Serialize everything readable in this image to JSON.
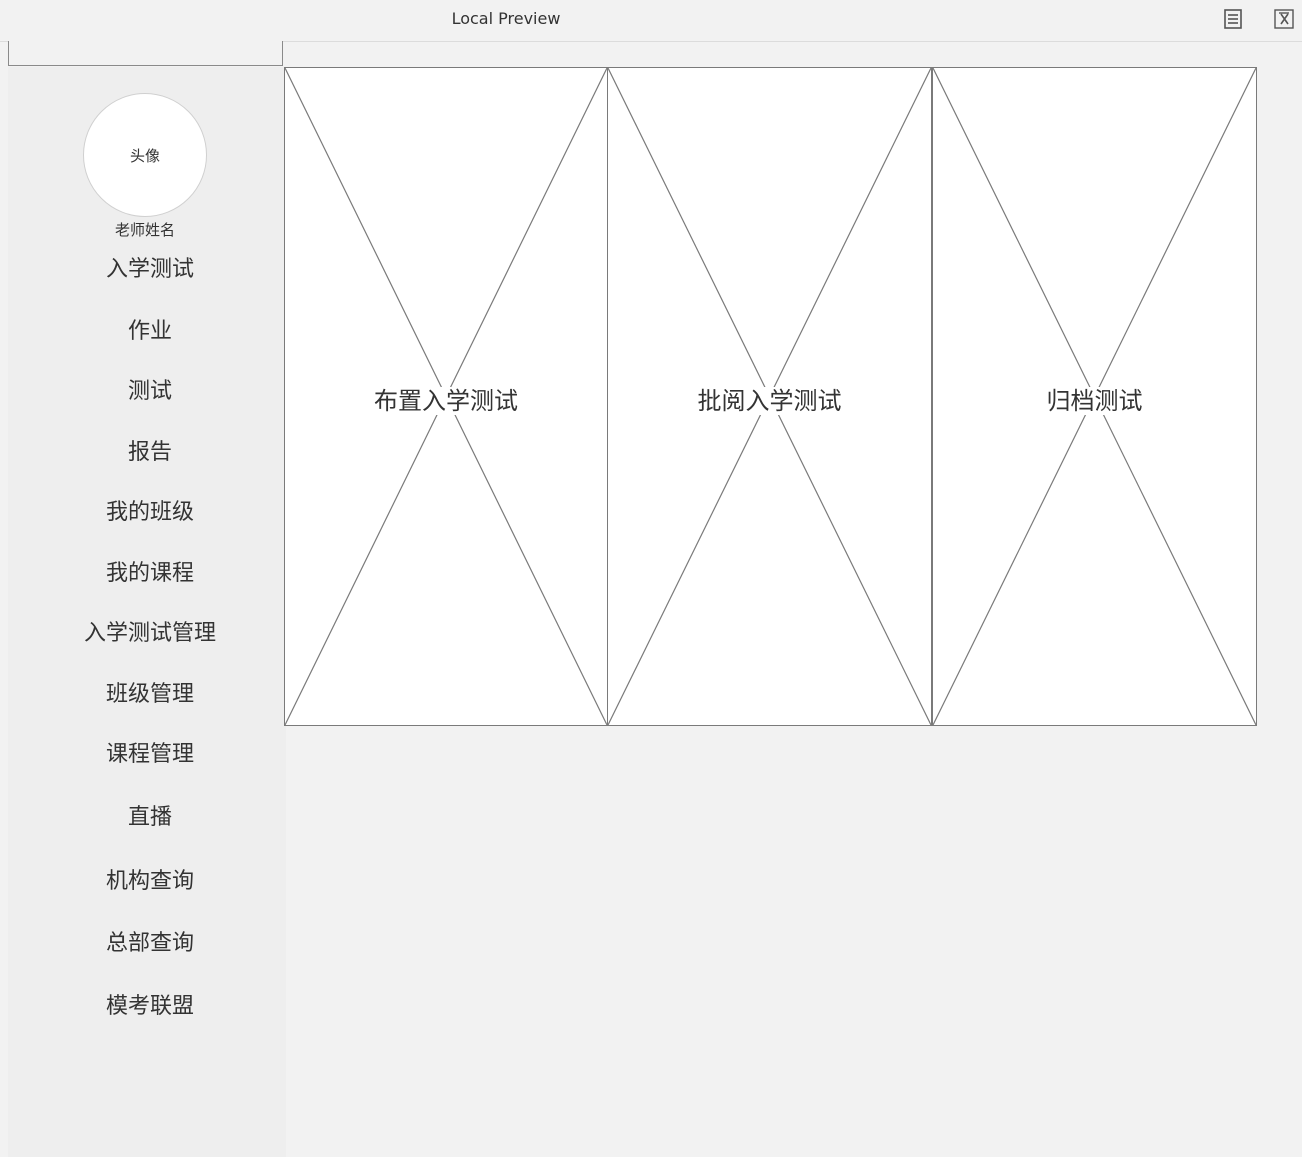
{
  "window": {
    "title": "Local Preview",
    "icons": [
      "document-list-icon",
      "formula-icon"
    ]
  },
  "sidebar": {
    "avatar_label": "头像",
    "teacher_name": "老师姓名",
    "items": [
      {
        "label": "入学测试"
      },
      {
        "label": "作业"
      },
      {
        "label": "测试"
      },
      {
        "label": "报告"
      },
      {
        "label": "我的班级"
      },
      {
        "label": "我的课程"
      },
      {
        "label": "入学测试管理"
      },
      {
        "label": "班级管理"
      },
      {
        "label": "课程管理"
      },
      {
        "label": "直播"
      },
      {
        "label": "机构查询"
      },
      {
        "label": "总部查询"
      },
      {
        "label": "模考联盟"
      }
    ]
  },
  "main": {
    "cards": [
      {
        "label": "布置入学测试"
      },
      {
        "label": "批阅入学测试"
      },
      {
        "label": "归档测试"
      }
    ]
  }
}
